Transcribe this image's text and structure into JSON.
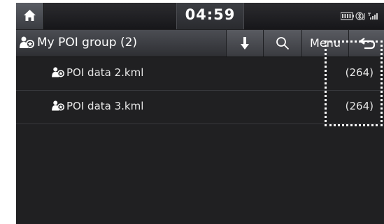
{
  "status": {
    "time": "04:59",
    "icons": [
      "home-icon",
      "battery-icon",
      "bluetooth-icon",
      "signal-icon"
    ]
  },
  "header": {
    "title": "My POI group (2)",
    "menu_label": "Menu",
    "icons": [
      "poi-group-icon",
      "download-icon",
      "search-icon",
      "back-icon"
    ]
  },
  "list": {
    "items": [
      {
        "label": "POI data 2.kml",
        "count": "(264)",
        "icon": "poi-file-icon"
      },
      {
        "label": "POI data 3.kml",
        "count": "(264)",
        "icon": "poi-file-icon"
      }
    ]
  },
  "colors": {
    "background": "#202022",
    "header": "#3a3b40",
    "text": "#e6e6e6",
    "focus": "#ffffff"
  }
}
